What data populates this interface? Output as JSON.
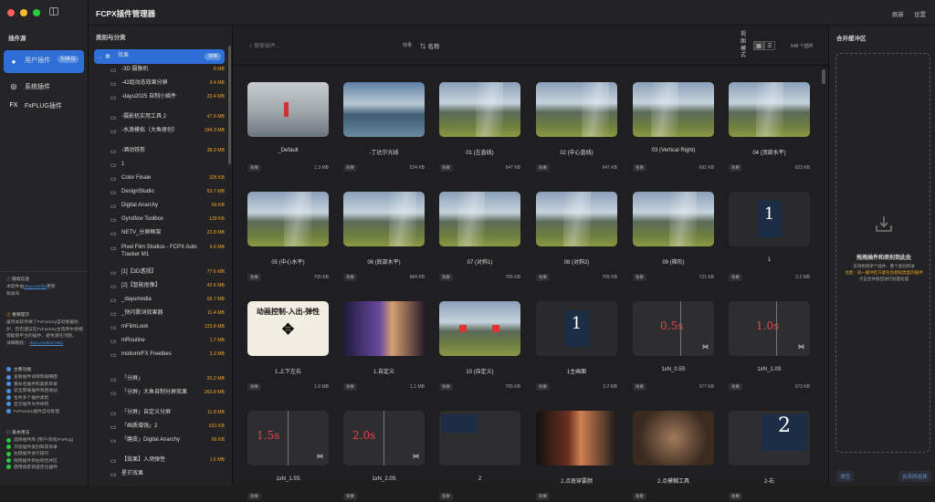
{
  "app": {
    "title": "FCPX插件管理器",
    "refresh": "刷新",
    "settings": "设置"
  },
  "left": {
    "section": "插件源",
    "sources": [
      {
        "label": "用户插件",
        "badge": "5.94 G",
        "icon": "user-icon"
      },
      {
        "label": "系统插件",
        "icon": "gear-icon"
      },
      {
        "label": "FxPLUG插件",
        "icon": "fx-icon"
      }
    ],
    "version": {
      "title": "版权信息",
      "text1": "本软件由",
      "link": "dayu.media",
      "text2": "更新",
      "text3": "和发布"
    },
    "notice": {
      "title": "重要提示",
      "text": "虽然本软件做了FxFactory自动重备防护，仍仍建议在FxFactory主程序中将相域能够平台的插件，避免潜在问题。",
      "more": "详细教程：",
      "link": "dayu.media/7961"
    },
    "features": {
      "title": "主要功能",
      "items": [
        "查看插件详情和缩略图",
        "重命名插件和类别目录",
        "安全卸载插件到回收站",
        "合并多个插件类别",
        "显示插件文件体积",
        "FxFactory插件自动处理"
      ]
    },
    "usage": {
      "title": "基本用法",
      "items": [
        "选择插件库 (用户/系统/FxPlug)",
        "浏览插件类别和其目录",
        "右键插件进行操作",
        "拖拽插件到右侧合并区",
        "使用搜索快速定位插件"
      ]
    }
  },
  "cats": {
    "title": "类别与分类",
    "active": {
      "name": "效果",
      "size": "5FB"
    },
    "items": [
      {
        "name": "-3D 摄像机",
        "size": "8 MB"
      },
      {
        "name": "-42组动态效果分屏",
        "size": "9.4 MB"
      },
      {
        "name": "-dayu2025 自制小插件",
        "size": "33.4 MB"
      },
      {
        "name": "-摄影机实用工具 2",
        "size": "47.6 MB"
      },
      {
        "name": "-水滴模拟（大鱼原创）",
        "size": "194.3 MB"
      },
      {
        "name": "-酒动铁剪",
        "size": "38.9 MB"
      },
      {
        "name": "1",
        "size": ""
      },
      {
        "name": "Color Finale",
        "size": "326 KB"
      },
      {
        "name": "DesignStudio",
        "size": "53.7 MB"
      },
      {
        "name": "Digital Anarchy",
        "size": "66 KB"
      },
      {
        "name": "Gyroflow Toolbox",
        "size": "139 KB"
      },
      {
        "name": "NETV_分屏框架",
        "size": "22.8 MB"
      },
      {
        "name": "Pixel Film Studios - FCPX Auto Tracker M1",
        "size": "6.6 MB"
      },
      {
        "name": "[1]【3D透视】",
        "size": "77.6 MB"
      },
      {
        "name": "[2]【智能抠像】",
        "size": "42.6 MB"
      },
      {
        "name": "_dayumedia",
        "size": "69.7 MB"
      },
      {
        "name": "_快闪歌词效果器",
        "size": "11.4 MB"
      },
      {
        "name": "mFilmLook",
        "size": "123.8 MB"
      },
      {
        "name": "mRoutine",
        "size": "1.7 MB"
      },
      {
        "name": "motionVFX Freebies",
        "size": "3.3 MB"
      },
      {
        "name": "「分屏」",
        "size": "20.2 MB"
      },
      {
        "name": "「分屏」大鱼自制分屏效果",
        "size": "263.8 MB"
      },
      {
        "name": "「分屏」自定义分屏",
        "size": "11.8 MB"
      },
      {
        "name": "「画质增强」2",
        "size": "631 KB"
      },
      {
        "name": "「磨皮」Digital Anarchy",
        "size": "66 KB"
      },
      {
        "name": "【效果】入场弹性",
        "size": "1.6 MB"
      },
      {
        "name": "星芒效果",
        "size": ""
      }
    ]
  },
  "main": {
    "search_placeholder": "搜索插件...",
    "scope": "效果",
    "sort": "名称",
    "view_mode": "视图模式",
    "count": "548 个插件",
    "items": [
      {
        "name": "_Default",
        "tag": "效果",
        "size": "1.3 MB"
      },
      {
        "name": "-丁达尔光线",
        "tag": "效果",
        "size": "524 KB"
      },
      {
        "name": "01 (左直线)",
        "tag": "效果",
        "size": "647 KB"
      },
      {
        "name": "02 (中心直线)",
        "tag": "效果",
        "size": "647 KB"
      },
      {
        "name": "03 (Vertical Right)",
        "tag": "效果",
        "size": "692 KB"
      },
      {
        "name": "04 (顶部水平)",
        "tag": "效果",
        "size": "623 KB"
      },
      {
        "name": "05 (中心水平)",
        "tag": "效果",
        "size": "705 KB"
      },
      {
        "name": "06 (底部水平)",
        "tag": "效果",
        "size": "684 KB"
      },
      {
        "name": "07 (对斜1)",
        "tag": "效果",
        "size": "705 KB"
      },
      {
        "name": "08 (对斜2)",
        "tag": "效果",
        "size": "705 KB"
      },
      {
        "name": "09 (梯形)",
        "tag": "效果",
        "size": "721 KB"
      },
      {
        "name": "1",
        "tag": "效果",
        "size": "3.2 MB"
      },
      {
        "name": "1.上下左右",
        "tag": "效果",
        "size": "1.6 MB",
        "thumb_text": "动画控制-入出-弹性"
      },
      {
        "name": "1.自定义",
        "tag": "效果",
        "size": "1.1 MB"
      },
      {
        "name": "10 (自定义)",
        "tag": "效果",
        "size": "765 KB"
      },
      {
        "name": "1主画面",
        "tag": "效果",
        "size": "3.2 MB"
      },
      {
        "name": "1xN_0.5S",
        "tag": "效果",
        "size": "377 KB",
        "thumb_text": "0.5s"
      },
      {
        "name": "1xN_1.0S",
        "tag": "效果",
        "size": "373 KB",
        "thumb_text": "1.0s"
      },
      {
        "name": "1xN_1.5S",
        "tag": "效果",
        "size": "",
        "thumb_text": "1.5s"
      },
      {
        "name": "1xN_2.0S",
        "tag": "效果",
        "size": "",
        "thumb_text": "2.0s"
      },
      {
        "name": "2",
        "tag": "效果",
        "size": ""
      },
      {
        "name": "2.点斑穿要颜",
        "tag": "效果",
        "size": ""
      },
      {
        "name": "2.点模糊工具",
        "tag": "效果",
        "size": ""
      },
      {
        "name": "2-右",
        "tag": "效果",
        "size": "",
        "thumb_text": "2"
      }
    ]
  },
  "right": {
    "title": "合并缓冲区",
    "drop_title": "拖拽插件和类别到此处",
    "drop_sub": "支持拖拽单个插件、整个类别目录",
    "drop_warn": "注意：同一缓冲区只能包含相同类型的插件",
    "drop_hint": "点击合并按钮进行批量处理",
    "clear": "清空",
    "merge": "合并所选择"
  },
  "colors": {
    "accent": "#2d6fd6",
    "size_orange": "#f5a623"
  }
}
